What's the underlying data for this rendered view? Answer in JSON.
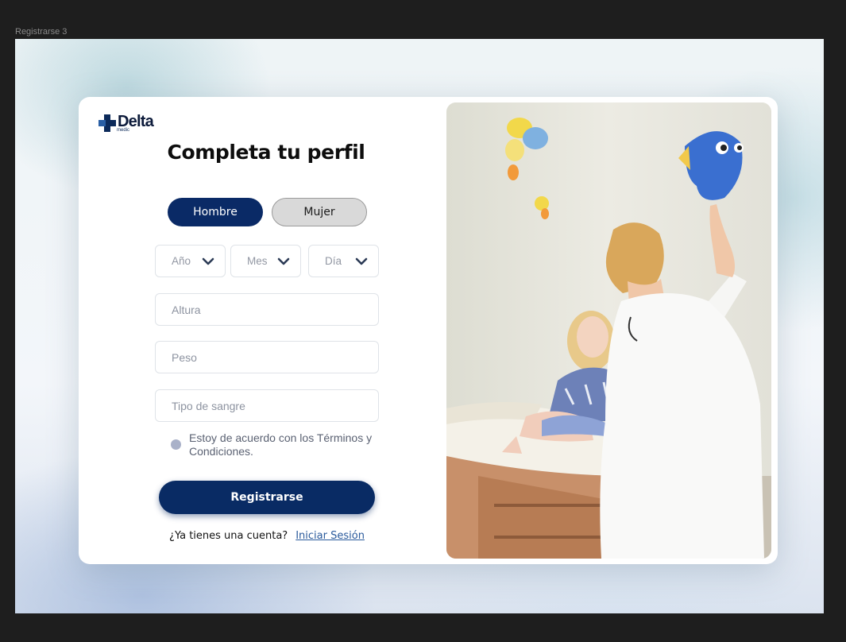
{
  "frame": {
    "label": "Registrarse 3"
  },
  "brand": {
    "name": "Delta",
    "sub": "medic"
  },
  "form": {
    "title": "Completa tu perfil",
    "gender": {
      "male": "Hombre",
      "female": "Mujer",
      "selected": "Hombre"
    },
    "birthdate": {
      "year": "Año",
      "month": "Mes",
      "day": "Día"
    },
    "height_placeholder": "Altura",
    "weight_placeholder": "Peso",
    "blood_placeholder": "Tipo de sangre",
    "terms": "Estoy de acuerdo con los Términos y Condiciones.",
    "submit": "Registrarse",
    "login_question": "¿Ya tienes una cuenta?",
    "login_link": "Iniciar Sesión"
  },
  "colors": {
    "primary": "#0a2a66",
    "link": "#2a5a9c",
    "inactive_button": "#d9d9d9",
    "radio": "#a9b1c9"
  },
  "photo": {
    "subject": "doctor-examining-child-illustration"
  }
}
